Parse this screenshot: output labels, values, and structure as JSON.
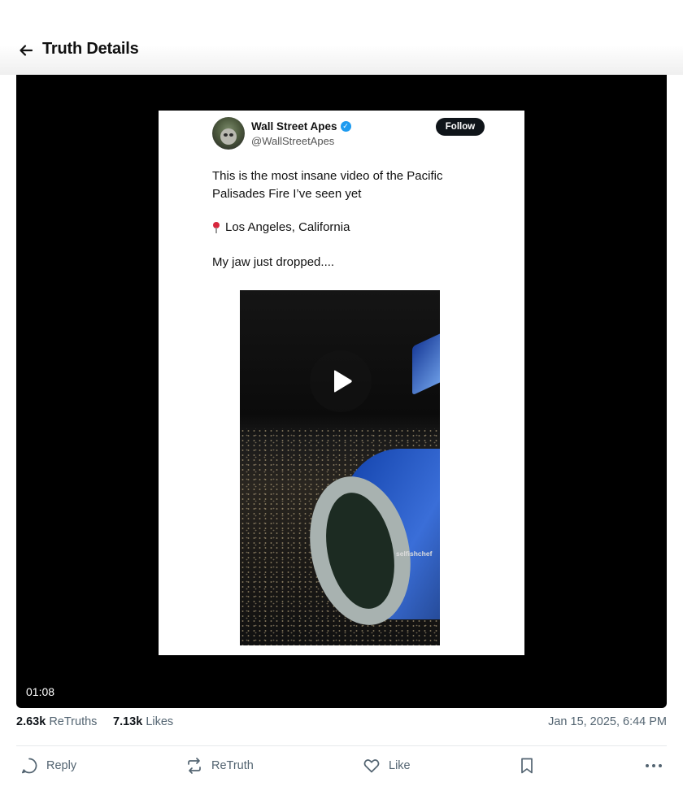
{
  "header": {
    "title": "Truth Details"
  },
  "post": {
    "embed": {
      "account_name": "Wall Street Apes",
      "account_handle": "@WallStreetApes",
      "follow_label": "Follow",
      "text_line1": "This is the most insane video of the Pacific Palisades Fire I’ve seen yet",
      "location": "Los Angeles, California",
      "text_line3": "My jaw just dropped....",
      "watermark": "selfishchef"
    },
    "video_duration": "01:08",
    "retruths_count": "2.63k",
    "retruths_label": "ReTruths",
    "likes_count": "7.13k",
    "likes_label": "Likes",
    "timestamp": "Jan 15, 2025, 6:44 PM"
  },
  "actions": {
    "reply": "Reply",
    "retruth": "ReTruth",
    "like": "Like"
  },
  "icons": [
    "arrow-left-icon",
    "play-icon",
    "pin-icon",
    "verified-icon",
    "reply-icon",
    "retruth-icon",
    "heart-icon",
    "bookmark-icon",
    "more-icon"
  ]
}
